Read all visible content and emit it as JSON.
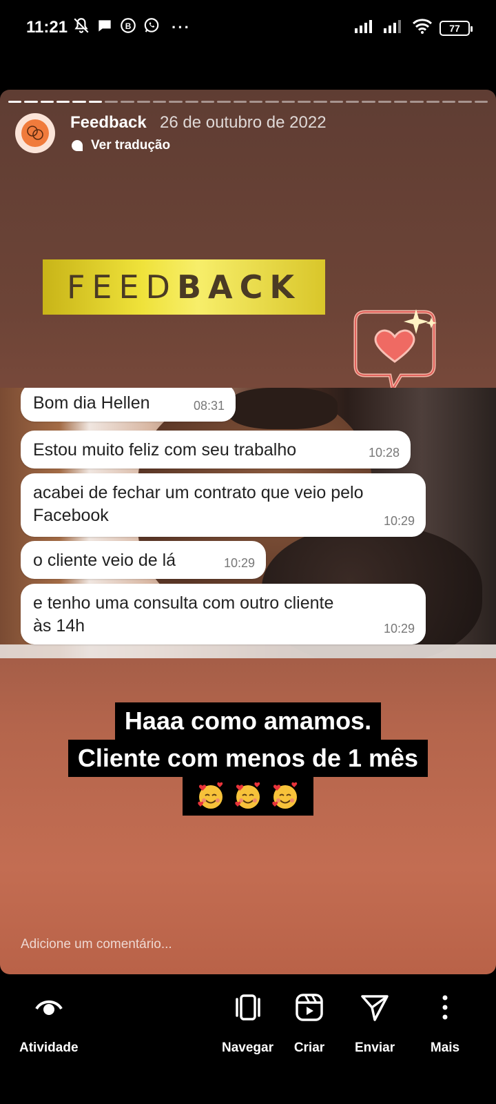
{
  "status_bar": {
    "time": "11:21",
    "dots": "···",
    "battery": "77"
  },
  "story": {
    "user": "Feedback",
    "date": "26 de outubro de 2022",
    "translate": "Ver tradução",
    "banner_thin": "FEED",
    "banner_bold": "BACK",
    "messages": [
      {
        "text": "Bom dia Hellen",
        "time": "08:31"
      },
      {
        "text": "Estou muito feliz com seu trabalho",
        "time": "10:28"
      },
      {
        "text": "acabei de fechar um contrato que veio pelo Facebook",
        "time": "10:29"
      },
      {
        "text": "o cliente veio de lá",
        "time": "10:29"
      },
      {
        "text": "e tenho uma consulta com outro cliente às 14h",
        "time": "10:29"
      }
    ],
    "caption_line1": "Haaa como amamos.",
    "caption_line2": "Cliente com menos de 1 mês",
    "caption_emoji_icon": "smiling-face-with-hearts-icon",
    "comment_placeholder": "Adicione um comentário..."
  },
  "bottom_nav": {
    "activity": "Atividade",
    "browse": "Navegar",
    "create": "Criar",
    "send": "Enviar",
    "more": "Mais"
  }
}
